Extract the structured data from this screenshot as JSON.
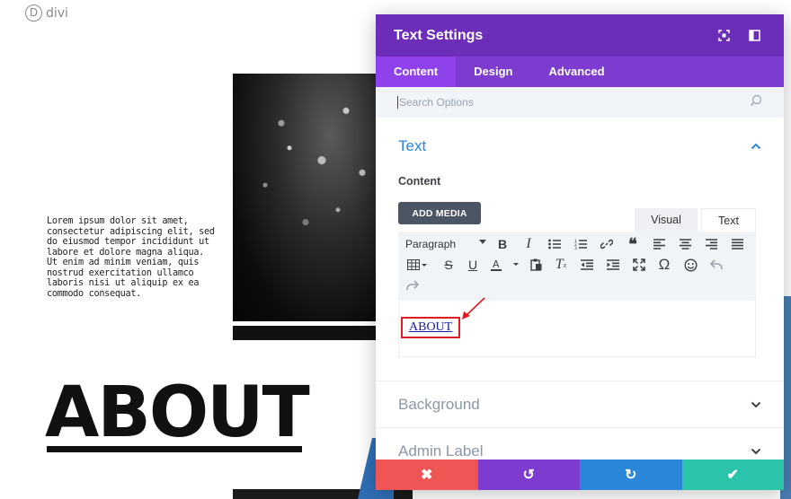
{
  "logo": {
    "mark": "D",
    "text": "divi"
  },
  "page": {
    "lorem": "Lorem ipsum dolor sit amet, consectetur adipiscing elit, sed do eiusmod tempor incididunt ut labore et dolore magna aliqua. Ut enim ad minim veniam, quis nostrud exercitation ullamco laboris nisi ut aliquip ex ea commodo consequat.",
    "heading": "ABOUT"
  },
  "modal": {
    "title": "Text Settings",
    "header_icons": [
      "expand-icon",
      "sidebar-toggle-icon"
    ],
    "tabs": [
      {
        "label": "Content",
        "active": true
      },
      {
        "label": "Design",
        "active": false
      },
      {
        "label": "Advanced",
        "active": false
      }
    ],
    "search": {
      "placeholder": "Search Options",
      "value": ""
    },
    "sections": {
      "text": {
        "title": "Text",
        "expanded": true
      },
      "background": {
        "title": "Background",
        "expanded": false
      },
      "admin_label": {
        "title": "Admin Label",
        "expanded": false
      }
    },
    "content_label": "Content",
    "add_media_label": "ADD MEDIA",
    "editor_modes": {
      "visual": "Visual",
      "text": "Text",
      "active": "text"
    },
    "toolbar": {
      "paragraph_select": "Paragraph",
      "row1_icons": [
        "bold-icon",
        "italic-icon",
        "bullet-list-icon",
        "numbered-list-icon",
        "link-icon",
        "blockquote-icon",
        "align-left-icon",
        "align-center-icon",
        "align-right-icon",
        "align-justify-icon"
      ],
      "row2_icons": [
        "table-icon",
        "strikethrough-icon",
        "underline-icon",
        "text-color-icon",
        "paste-icon",
        "clear-format-icon",
        "outdent-icon",
        "indent-icon",
        "fullscreen-icon",
        "omega-icon",
        "emoji-icon",
        "undo-icon"
      ],
      "row3_icons": [
        "redo-icon"
      ]
    },
    "editor_content": "ABOUT",
    "footer": {
      "cancel": "✖",
      "undo": "↺",
      "redo": "↻",
      "save": "✔"
    },
    "colors": {
      "header": "#6c2eb9",
      "tabs_bar": "#7e3bd0",
      "active_tab": "#8f42ec",
      "accent_blue": "#2b87da",
      "cancel": "#ef5555",
      "save": "#29c4a9",
      "highlight": "#e11b22"
    }
  }
}
